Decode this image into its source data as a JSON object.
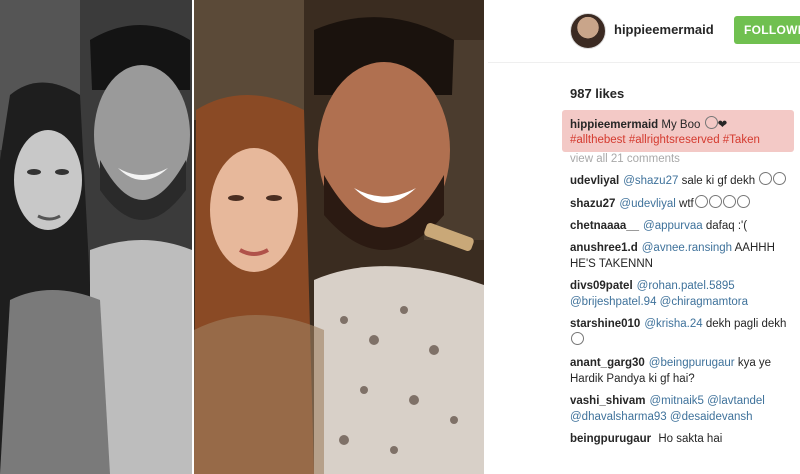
{
  "header": {
    "username": "hippieemermaid",
    "follow_label": "FOLLOWING"
  },
  "post": {
    "likes": "987 likes",
    "caption_user": "hippieemermaid",
    "caption_text": "My Boo",
    "caption_hashtags": "#allthebest #allrightsreserved #Taken",
    "view_all": "view all 21 comments"
  },
  "comments": [
    {
      "user": "udevliyal",
      "mention": "@shazu27",
      "text": "sale ki gf dekh"
    },
    {
      "user": "shazu27",
      "mention": "@udevliyal",
      "text": "wtf"
    },
    {
      "user": "chetnaaaa__",
      "mention": "@appurvaa",
      "text": "dafaq :'("
    },
    {
      "user": "anushree1.d",
      "mention": "@avnee.ransingh",
      "text": "AAHHH HE'S TAKENNN"
    },
    {
      "user": "divs09patel",
      "mention": "@rohan.patel.5895 @brijeshpatel.94 @chiragmamtora",
      "text": ""
    },
    {
      "user": "starshine010",
      "mention": "@krisha.24",
      "text": "dekh pagli dekh"
    },
    {
      "user": "anant_garg30",
      "mention": "@beingpurugaur",
      "text": "kya ye Hardik Pandya ki gf hai?"
    },
    {
      "user": "vashi_shivam",
      "mention": "@mitnaik5 @lavtandel @dhavalsharma93 @desaidevansh",
      "text": ""
    },
    {
      "user": "beingpurugaur",
      "mention": "",
      "text": "Ho sakta hai"
    }
  ]
}
